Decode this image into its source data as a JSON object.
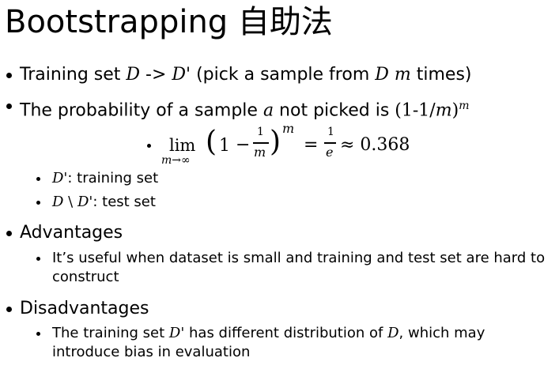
{
  "slide": {
    "title": "Bootstrapping 自助法",
    "bullets": {
      "training_set": {
        "text_a": "Training set ",
        "D": "D",
        "arrow": " -> ",
        "Dprime": "D'",
        "text_b": " (pick a sample from ",
        "D2": "D",
        "m": "m",
        "text_c": " times)"
      },
      "probability": {
        "text_a": "The probability of a sample ",
        "a": "a",
        "text_b": " not picked is ",
        "expr_a": "(1-1/",
        "m": "m",
        "expr_b": ")",
        "sup_m": "m"
      },
      "formula": {
        "lim": "lim",
        "sub": "m→∞",
        "open": "(",
        "one": "1",
        "minus": "−",
        "frac_num": "1",
        "frac_den": "m",
        "close": ")",
        "exp": "m",
        "equals": "=",
        "rhs_num": "1",
        "rhs_den": "e",
        "approx": "≈ 0.368"
      },
      "sub_training": {
        "Dprime": "D'",
        "text": ": training set"
      },
      "sub_test": {
        "D": "D",
        "setminus": " \\ ",
        "Dprime": "D'",
        "text": ": test set"
      },
      "advantages": {
        "heading": "Advantages",
        "item_line1": "It’s useful when dataset is small and training and test set are hard to",
        "item_line2": "construct"
      },
      "disadvantages": {
        "heading": "Disadvantages",
        "item_a": "The training set ",
        "Dprime": "D'",
        "item_b": " has different distribution of ",
        "D": "D",
        "item_c": ", which may",
        "item_line2": "introduce bias in evaluation"
      }
    }
  }
}
